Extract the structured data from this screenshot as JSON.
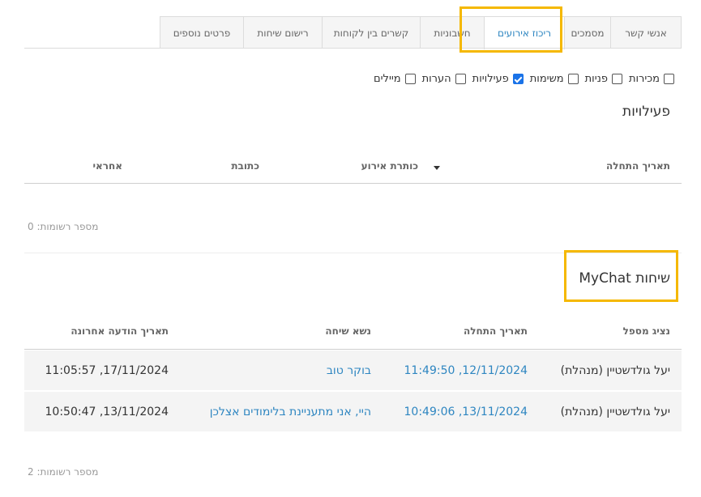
{
  "tabs": [
    {
      "label": "אנשי קשר"
    },
    {
      "label": "מסמכים"
    },
    {
      "label": "ריכוז אירועים"
    },
    {
      "label": "חשבוניות"
    },
    {
      "label": "קשרים בין לקוחות"
    },
    {
      "label": "רישום שיחות"
    },
    {
      "label": "פרטים נוספים"
    }
  ],
  "active_tab": "ריכוז אירועים",
  "filters": [
    {
      "label": "מכירות",
      "checked": false
    },
    {
      "label": "פניות",
      "checked": false
    },
    {
      "label": "משימות",
      "checked": false
    },
    {
      "label": "פעילויות",
      "checked": true
    },
    {
      "label": "הערות",
      "checked": false
    },
    {
      "label": "מיילים",
      "checked": false
    }
  ],
  "activities": {
    "title": "פעילויות",
    "columns": {
      "start_date": "תאריך התחלה",
      "event_title": "כותרת אירוע",
      "address": "כתובת",
      "owner": "אחראי"
    },
    "record_count": "מספר רשומות: 0"
  },
  "chats": {
    "title": "שיחות MyChat",
    "columns": {
      "agent": "נציג מספל",
      "start_date": "תאריך התחלה",
      "subject": "נשא שיחה",
      "last_message": "תאריך הודעה אחרונה"
    },
    "rows": [
      {
        "agent": "יעל גולדשטיין (מנהלת)",
        "start_date": "12/11/2024, 11:49:50",
        "subject": "בוקר טוב",
        "last_message": "17/11/2024, 11:05:57"
      },
      {
        "agent": "יעל גולדשטיין (מנהלת)",
        "start_date": "13/11/2024, 10:49:06",
        "subject": "היי, אני מתעניינת בלימודים אצלכן",
        "last_message": "13/11/2024, 10:50:47"
      }
    ],
    "record_count": "מספר רשומות: 2"
  },
  "colors": {
    "accent": "#2e86c1",
    "highlight": "#f5b800",
    "checkbox_checked": "#1a73e8",
    "row_bg": "#f4f4f4"
  }
}
